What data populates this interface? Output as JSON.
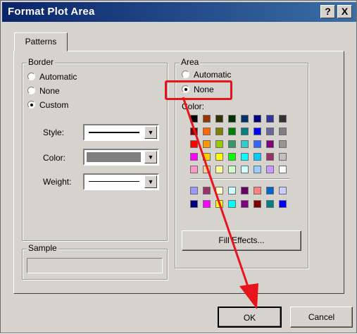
{
  "window": {
    "title": "Format Plot Area",
    "help_label": "?",
    "close_label": "X"
  },
  "tabs": [
    {
      "label": "Patterns",
      "selected": true
    }
  ],
  "border": {
    "legend": "Border",
    "options": [
      {
        "label": "Automatic",
        "selected": false
      },
      {
        "label": "None",
        "selected": false
      },
      {
        "label": "Custom",
        "selected": true
      }
    ],
    "style_label": "Style:",
    "color_label": "Color:",
    "weight_label": "Weight:",
    "style_value": "solid-line",
    "color_value": "#7f7f7f",
    "weight_value": "thin-line"
  },
  "area": {
    "legend": "Area",
    "options": [
      {
        "label": "Automatic",
        "selected": false
      },
      {
        "label": "None",
        "selected": true
      }
    ],
    "color_label": "Color:",
    "fill_effects_label": "Fill Effects...",
    "palette_main": [
      [
        "#000000",
        "#993300",
        "#333300",
        "#003300",
        "#003366",
        "#000080",
        "#333399",
        "#333333"
      ],
      [
        "#800000",
        "#FF6600",
        "#808000",
        "#008000",
        "#008080",
        "#0000FF",
        "#666699",
        "#808080"
      ],
      [
        "#FF0000",
        "#FF9900",
        "#99CC00",
        "#339966",
        "#33CCCC",
        "#3366FF",
        "#800080",
        "#969696"
      ],
      [
        "#FF00FF",
        "#FFCC00",
        "#FFFF00",
        "#00FF00",
        "#00FFFF",
        "#00CCFF",
        "#993366",
        "#C0C0C0"
      ],
      [
        "#FF99CC",
        "#FFCC99",
        "#FFFF99",
        "#CCFFCC",
        "#CCFFFF",
        "#99CCFF",
        "#CC99FF",
        "#FFFFFF"
      ]
    ],
    "palette_extra": [
      [
        "#9999FF",
        "#993366",
        "#FFFFCC",
        "#CCFFFF",
        "#660066",
        "#FF8080",
        "#0066CC",
        "#CCCCFF"
      ],
      [
        "#000080",
        "#FF00FF",
        "#FFFF00",
        "#00FFFF",
        "#800080",
        "#800000",
        "#008080",
        "#0000FF"
      ]
    ]
  },
  "sample": {
    "legend": "Sample"
  },
  "buttons": {
    "ok_label": "OK",
    "cancel_label": "Cancel"
  },
  "annotation": {
    "highlight_color": "#e8141b"
  }
}
